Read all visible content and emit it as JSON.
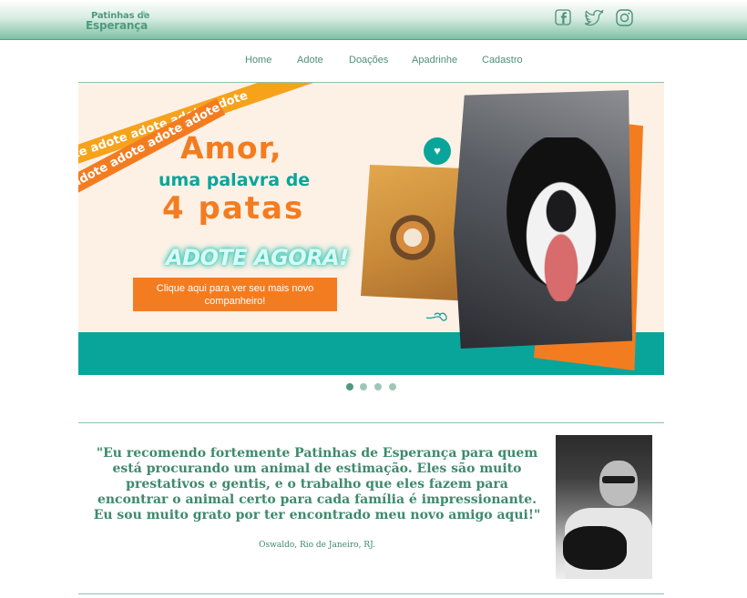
{
  "header": {
    "logo_line1": "Patinhas de",
    "logo_line2": "Esperança",
    "social": [
      "facebook-icon",
      "twitter-icon",
      "instagram-icon"
    ]
  },
  "nav": {
    "items": [
      "Home",
      "Adote",
      "Doações",
      "Apadrinhe",
      "Cadastro"
    ]
  },
  "banner": {
    "tape_text": "adote adote adote adote adote",
    "headline_line1": "Amor,",
    "headline_line2": "uma palavra de",
    "headline_line3": "4 patas",
    "cta_heading": "ADOTE AGORA!",
    "cta_button": "Clique aqui para ver seu mais novo companheiro!",
    "colors": {
      "orange": "#f47c20",
      "teal": "#0aa59a",
      "yellow": "#f7a21b",
      "cream": "#fdf1e6"
    }
  },
  "carousel": {
    "slides": 4,
    "active_index": 0
  },
  "testimonial": {
    "quote": "\"Eu recomendo fortemente Patinhas de Esperança para quem está procurando um animal de estimação. Eles são muito prestativos e gentis, e o trabalho que eles fazem para encontrar o animal certo para cada família é impressionante. Eu sou muito grato por ter encontrado meu novo amigo aqui!\"",
    "author": "Oswaldo, Rio de Janeiro, RJ."
  }
}
